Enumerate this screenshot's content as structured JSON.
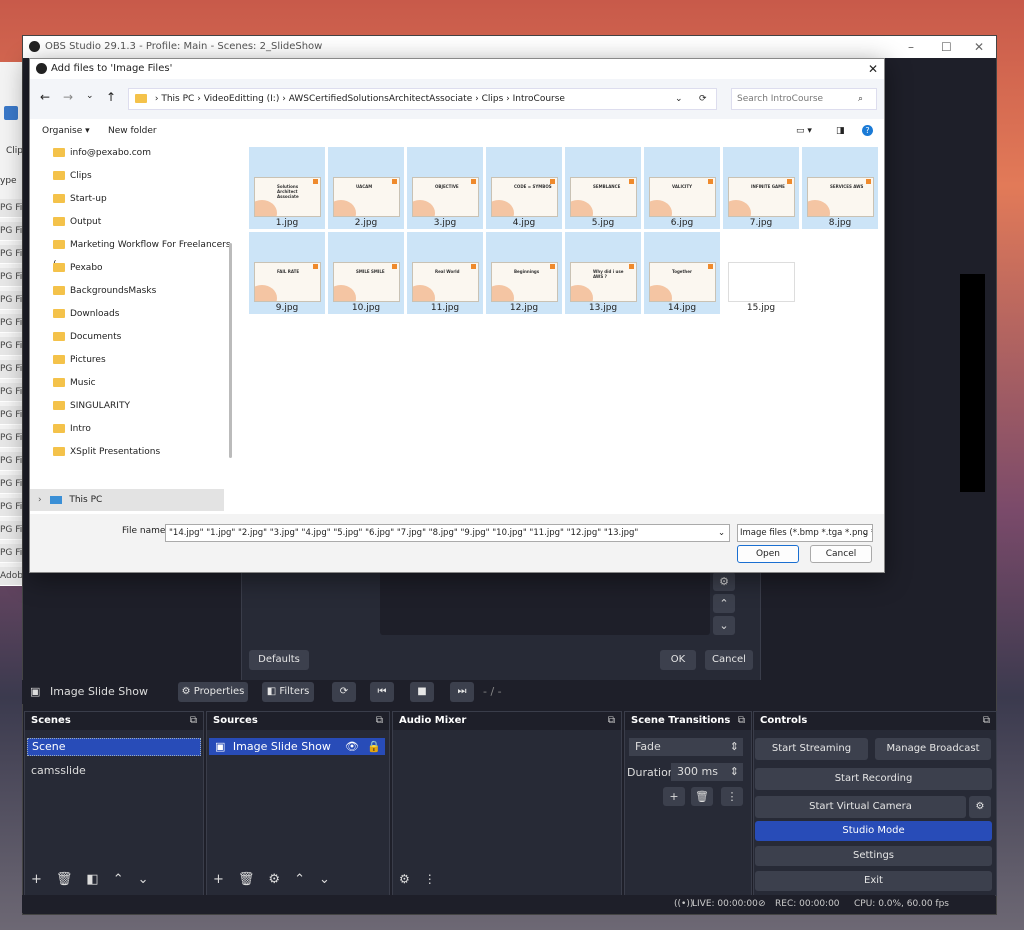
{
  "obs": {
    "title": "OBS Studio 29.1.3 - Profile: Main - Scenes: 2_SlideShow",
    "minimize": "–",
    "maximize": "☐",
    "close": "✕"
  },
  "bg_explorer": {
    "left_tab": "Clip",
    "type_label": "ype",
    "rows": [
      "PG Fil",
      "PG Fil",
      "PG Fil",
      "PG Fil",
      "PG Fil",
      "PG Fil",
      "PG Fil",
      "PG Fil",
      "PG Fil",
      "PG Fil",
      "PG Fil",
      "PG Fil",
      "PG Fil",
      "PG Fil",
      "PG Fil",
      "PG Fil",
      "Adobe"
    ]
  },
  "properties": {
    "defaults": "Defaults",
    "ok": "OK",
    "cancel": "Cancel"
  },
  "source_bar": {
    "source_name": "Image Slide Show",
    "properties": "Properties",
    "filters": "Filters",
    "counter": "- / -"
  },
  "docks": {
    "scenes": {
      "title": "Scenes",
      "items": [
        "Scene",
        "camsslide"
      ]
    },
    "sources": {
      "title": "Sources",
      "items": [
        "Image Slide Show"
      ]
    },
    "audio": {
      "title": "Audio Mixer"
    },
    "transitions": {
      "title": "Scene Transitions",
      "type": "Fade",
      "duration_label": "Duration",
      "duration": "300 ms"
    },
    "controls": {
      "title": "Controls",
      "start_streaming": "Start Streaming",
      "manage_broadcast": "Manage Broadcast",
      "start_recording": "Start Recording",
      "start_virtual_camera": "Start Virtual Camera",
      "studio_mode": "Studio Mode",
      "settings": "Settings",
      "exit": "Exit"
    }
  },
  "status": {
    "live": "LIVE: 00:00:00",
    "rec": "REC: 00:00:00",
    "cpu": "CPU: 0.0%, 60.00 fps"
  },
  "file_dialog": {
    "title": "Add files to 'Image Files'",
    "close": "✕",
    "breadcrumb": [
      "This PC",
      "VideoEditting (I:)",
      "AWSCertifiedSolutionsArchitectAssociate",
      "Clips",
      "IntroCourse"
    ],
    "search_placeholder": "Search IntroCourse",
    "organise": "Organise ▾",
    "new_folder": "New folder",
    "sidebar": [
      {
        "label": "info@pexabo.com",
        "pinned": true
      },
      {
        "label": "Clips",
        "pinned": true
      },
      {
        "label": "Start-up",
        "pinned": true
      },
      {
        "label": "Output",
        "pinned": true
      },
      {
        "label": "Marketing Workflow For Freelancers (",
        "pinned": true
      },
      {
        "label": "Pexabo",
        "pinned": true
      },
      {
        "label": "BackgroundsMasks",
        "pinned": true
      },
      {
        "label": "Downloads",
        "pinned": true
      },
      {
        "label": "Documents",
        "pinned": true
      },
      {
        "label": "Pictures",
        "pinned": true
      },
      {
        "label": "Music",
        "pinned": true
      },
      {
        "label": "SINGULARITY",
        "pinned": true
      },
      {
        "label": "Intro",
        "pinned": false
      },
      {
        "label": "XSplit Presentations",
        "pinned": false
      }
    ],
    "this_pc": "This PC",
    "files": [
      {
        "name": "1.jpg",
        "caption": "Solutions Architect Associate"
      },
      {
        "name": "2.jpg",
        "caption": "UACAM"
      },
      {
        "name": "3.jpg",
        "caption": "OBJECTIVE"
      },
      {
        "name": "4.jpg",
        "caption": "CODE = SYMBOS"
      },
      {
        "name": "5.jpg",
        "caption": "SEMBLANCE"
      },
      {
        "name": "6.jpg",
        "caption": "VALICITY"
      },
      {
        "name": "7.jpg",
        "caption": "INFINITE GAME"
      },
      {
        "name": "8.jpg",
        "caption": "SERVICES AWS"
      },
      {
        "name": "9.jpg",
        "caption": "FAIL RATE"
      },
      {
        "name": "10.jpg",
        "caption": "SMILE SMILE"
      },
      {
        "name": "11.jpg",
        "caption": "Real World"
      },
      {
        "name": "12.jpg",
        "caption": "Beginnings"
      },
      {
        "name": "13.jpg",
        "caption": "Why did i use AWS ?"
      },
      {
        "name": "14.jpg",
        "caption": "Together"
      },
      {
        "name": "15.jpg",
        "caption": ""
      }
    ],
    "filename_label": "File name:",
    "filename_value": "\"14.jpg\" \"1.jpg\" \"2.jpg\" \"3.jpg\" \"4.jpg\" \"5.jpg\" \"6.jpg\" \"7.jpg\" \"8.jpg\" \"9.jpg\" \"10.jpg\" \"11.jpg\" \"12.jpg\" \"13.jpg\"",
    "filter": "Image files (*.bmp *.tga *.png *",
    "open": "Open",
    "cancel": "Cancel"
  },
  "colors": {
    "obs_bg": "#1e1f29",
    "dock_bg": "#272a36",
    "accent": "#284cb8",
    "selection": "#cce4f7"
  }
}
